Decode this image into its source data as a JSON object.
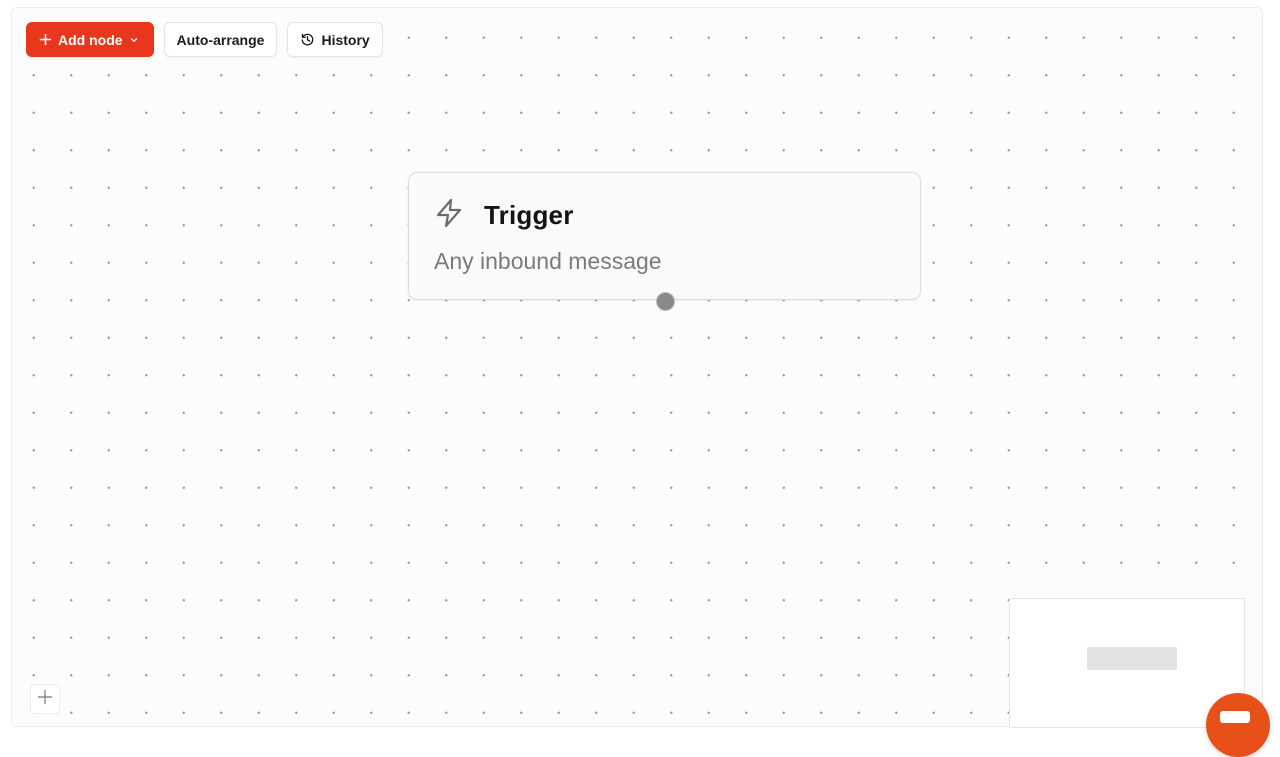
{
  "toolbar": {
    "add_node_label": "Add node",
    "auto_arrange_label": "Auto-arrange",
    "history_label": "History"
  },
  "node": {
    "title": "Trigger",
    "description": "Any inbound message"
  },
  "icons": {
    "add": "plus-icon",
    "dropdown": "chevron-down-icon",
    "history": "history-icon",
    "trigger": "lightning-icon",
    "zoom_in": "plus-icon",
    "help": "chat-icon"
  },
  "colors": {
    "accent": "#e8371c",
    "help_fab": "#e8501a"
  }
}
